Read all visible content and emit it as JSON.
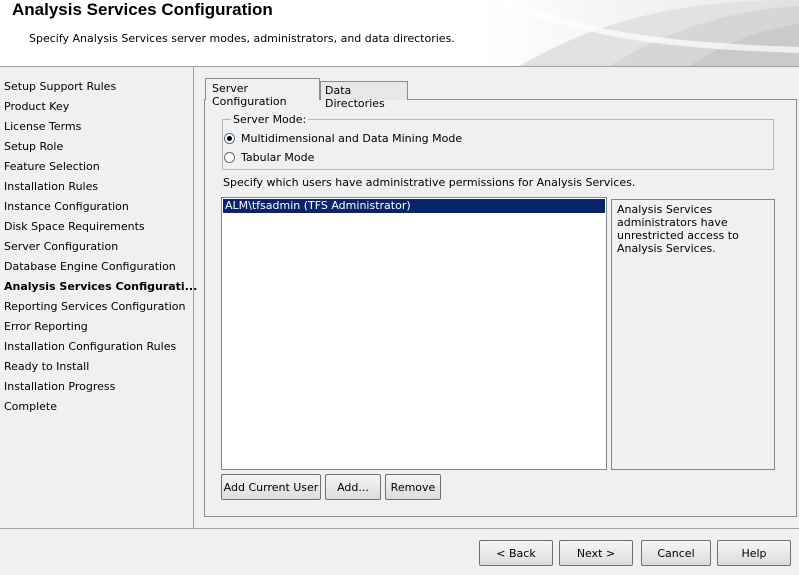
{
  "header": {
    "title": "Analysis Services Configuration",
    "subtitle": "Specify Analysis Services server modes, administrators, and data directories."
  },
  "sidebar": {
    "items": [
      {
        "label": "Setup Support Rules",
        "active": false
      },
      {
        "label": "Product Key",
        "active": false
      },
      {
        "label": "License Terms",
        "active": false
      },
      {
        "label": "Setup Role",
        "active": false
      },
      {
        "label": "Feature Selection",
        "active": false
      },
      {
        "label": "Installation Rules",
        "active": false
      },
      {
        "label": "Instance Configuration",
        "active": false
      },
      {
        "label": "Disk Space Requirements",
        "active": false
      },
      {
        "label": "Server Configuration",
        "active": false
      },
      {
        "label": "Database Engine Configuration",
        "active": false
      },
      {
        "label": "Analysis Services Configurati...",
        "active": true
      },
      {
        "label": "Reporting Services Configuration",
        "active": false
      },
      {
        "label": "Error Reporting",
        "active": false
      },
      {
        "label": "Installation Configuration Rules",
        "active": false
      },
      {
        "label": "Ready to Install",
        "active": false
      },
      {
        "label": "Installation Progress",
        "active": false
      },
      {
        "label": "Complete",
        "active": false
      }
    ]
  },
  "tabs": [
    {
      "label": "Server Configuration",
      "selected": true
    },
    {
      "label": "Data Directories",
      "selected": false
    }
  ],
  "server_mode": {
    "legend": "Server Mode:",
    "options": [
      {
        "label": "Multidimensional and Data Mining Mode",
        "checked": true
      },
      {
        "label": "Tabular Mode",
        "checked": false
      }
    ]
  },
  "permissions": {
    "label": "Specify which users have administrative permissions for Analysis Services.",
    "users": [
      "ALM\\tfsadmin (TFS Administrator)"
    ],
    "description": "Analysis Services administrators have unrestricted access to Analysis Services."
  },
  "user_buttons": {
    "add_current_user": "Add Current User",
    "add": "Add...",
    "remove": "Remove"
  },
  "nav_buttons": {
    "back": "< Back",
    "next": "Next >",
    "cancel": "Cancel",
    "help": "Help"
  },
  "colors": {
    "selection": "#0a246a",
    "background": "#f0f0f0"
  }
}
